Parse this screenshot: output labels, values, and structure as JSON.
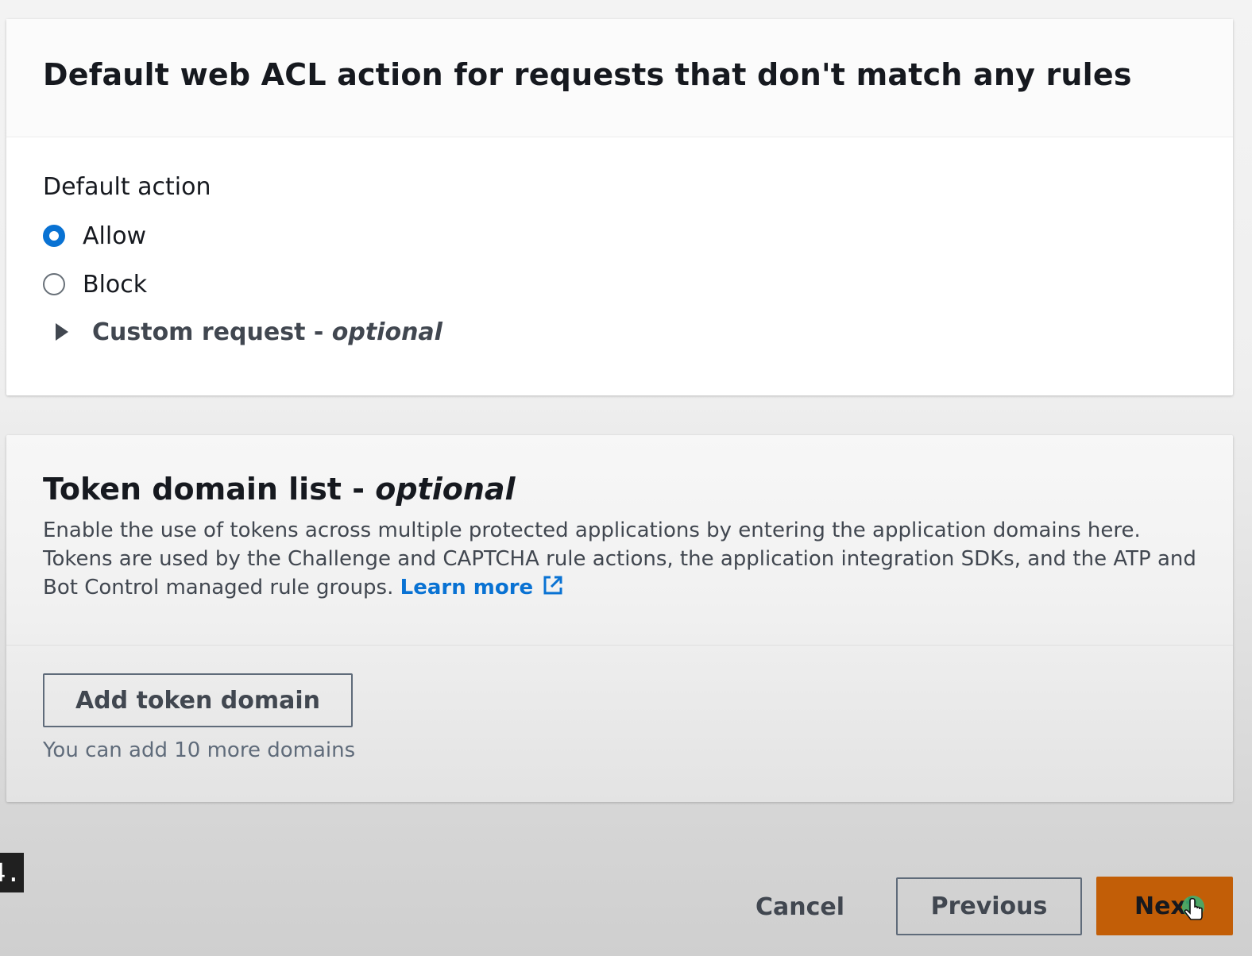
{
  "default_action_panel": {
    "title": "Default web ACL action for requests that don't match any rules",
    "field_label": "Default action",
    "options": [
      {
        "label": "Allow",
        "selected": true
      },
      {
        "label": "Block",
        "selected": false
      }
    ],
    "expander": {
      "label": "Custom request - ",
      "optional": "optional"
    }
  },
  "token_panel": {
    "title": "Token domain list - ",
    "title_optional": "optional",
    "description": "Enable the use of tokens across multiple protected applications by entering the application domains here. Tokens are used by the Challenge and CAPTCHA rule actions, the application integration SDKs, and the ATP and Bot Control managed rule groups.",
    "learn_more": "Learn more",
    "add_button": "Add token domain",
    "helper": "You can add 10 more domains"
  },
  "footer": {
    "left_tag": "4.",
    "cancel": "Cancel",
    "previous": "Previous",
    "next": "Next"
  },
  "colors": {
    "accent": "#0972d3",
    "primary_button": "#c25e07"
  },
  "icons": {
    "external_link": "external-link-icon",
    "caret": "caret-right-icon",
    "cursor": "hand-pointer-icon"
  }
}
